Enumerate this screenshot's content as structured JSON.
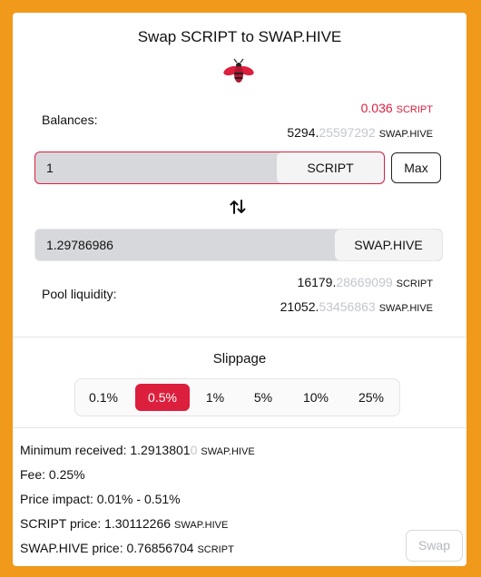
{
  "title": "Swap SCRIPT to SWAP.HIVE",
  "logo_icon": "bee-icon",
  "balances": {
    "label": "Balances:",
    "script_amount": "0.036",
    "script_unit": "SCRIPT",
    "hive_int": "5294.",
    "hive_dec": "25597292",
    "hive_unit": "SWAP.HIVE"
  },
  "input_from": {
    "value": "1",
    "token": "SCRIPT"
  },
  "max_label": "Max",
  "swap_direction_icon": "arrows-up-down-icon",
  "input_to": {
    "value": "1.29786986",
    "token": "SWAP.HIVE"
  },
  "pool": {
    "label": "Pool liquidity:",
    "script_int": "16179.",
    "script_dec": "28669099",
    "script_unit": "SCRIPT",
    "hive_int": "21052.",
    "hive_dec": "53456863",
    "hive_unit": "SWAP.HIVE"
  },
  "slippage": {
    "title": "Slippage",
    "options": [
      "0.1%",
      "0.5%",
      "1%",
      "5%",
      "10%",
      "25%"
    ],
    "selected": "0.5%"
  },
  "details": {
    "min_received_label": "Minimum received: ",
    "min_received_value": "1.2913801",
    "min_received_faint": "0",
    "min_received_unit": "SWAP.HIVE",
    "fee": "Fee: 0.25%",
    "price_impact": "Price impact: 0.01% - 0.51%",
    "script_price_label": "SCRIPT price: ",
    "script_price_value": "1.30112266",
    "script_price_unit": "SWAP.HIVE",
    "hive_price_label": "SWAP.HIVE price: ",
    "hive_price_value": "0.76856704",
    "hive_price_unit": "SCRIPT"
  },
  "swap_button": "Swap",
  "colors": {
    "accent": "#dc1f3d",
    "frame": "#f0991a"
  }
}
